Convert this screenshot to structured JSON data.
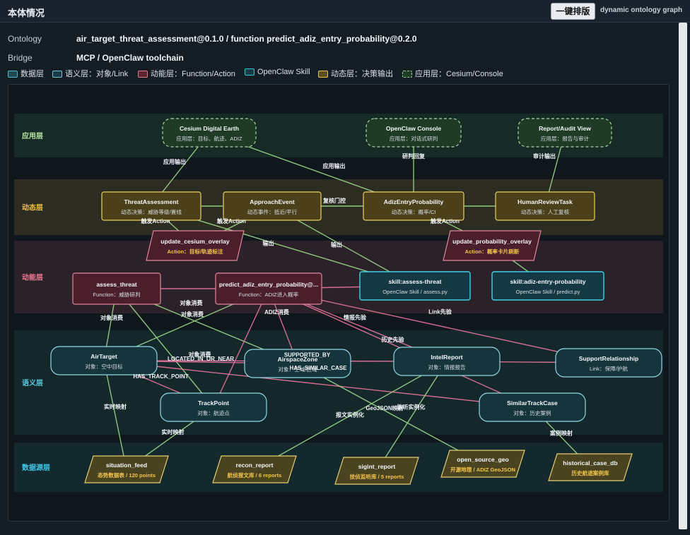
{
  "header": {
    "title": "本体情况",
    "layout_button": "一键排版",
    "subtitle": "dynamic ontology graph"
  },
  "info": {
    "ontology_label": "Ontology",
    "ontology_value": "air_target_threat_assessment@0.1.0 / function predict_adiz_entry_probability@0.2.0",
    "bridge_label": "Bridge",
    "bridge_value": "MCP / OpenClaw toolchain"
  },
  "legend": [
    {
      "label": "数据层",
      "color": "#1e4b52",
      "border": "#4fb7c6"
    },
    {
      "label": "语义层：对象/Link",
      "color": "#1c3b45",
      "border": "#6fc6d6"
    },
    {
      "label": "动能层：Function/Action",
      "color": "#5a2530",
      "border": "#e07890"
    },
    {
      "label": "OpenClaw Skill",
      "color": "#173c46",
      "border": "#36c3d8"
    },
    {
      "label": "动态层：决策输出",
      "color": "#5b4d1c",
      "border": "#e6c454"
    },
    {
      "label": "应用层：Cesium/Console",
      "color": "#1f3b25",
      "border": "#8fd18f"
    }
  ],
  "colors": {
    "app": {
      "band": "#162a26",
      "label": "#b8e6a0",
      "fill": "#1f3a25",
      "stroke": "#a5d8a0"
    },
    "dyn": {
      "band": "#2d2c22",
      "label": "#f0c040",
      "fill": "#4b4019",
      "stroke": "#ead060"
    },
    "func": {
      "band": "#2b2229",
      "label": "#f07890",
      "fill": "#4a1f2b",
      "stroke": "#e0869a"
    },
    "skill": {
      "fill": "#143942",
      "stroke": "#3ed2e8"
    },
    "sem": {
      "band": "#14282c",
      "label": "#58c8dc",
      "fill": "#15343c",
      "stroke": "#8fd8e4"
    },
    "data": {
      "band": "#14292e",
      "label": "#40c8e8",
      "fill": "#4a4320",
      "stroke": "#e8d070"
    },
    "edge_green": "#9bd68a",
    "edge_pink": "#e8749a"
  },
  "bands": [
    {
      "id": "app",
      "label": "应用层"
    },
    {
      "id": "dyn",
      "label": "动态层"
    },
    {
      "id": "func",
      "label": "动能层"
    },
    {
      "id": "sem",
      "label": "语义层"
    },
    {
      "id": "data",
      "label": "数据源层"
    }
  ],
  "nodes": [
    {
      "id": "cesium",
      "layer": "app",
      "title": "Cesium Digital Earth",
      "sub": "应用层：目标、航迹、ADIZ"
    },
    {
      "id": "console",
      "layer": "app",
      "title": "OpenClaw Console",
      "sub": "应用层：对话式研判"
    },
    {
      "id": "report",
      "layer": "app",
      "title": "Report/Audit View",
      "sub": "应用层：报告与审计"
    },
    {
      "id": "threat",
      "layer": "dyn",
      "title": "ThreatAssessment",
      "sub": "动态决策：威胁等级/置线"
    },
    {
      "id": "approach",
      "layer": "dyn",
      "title": "ApproachEvent",
      "sub": "动态事件：抵近/平行"
    },
    {
      "id": "adizprob",
      "layer": "dyn",
      "title": "AdizEntryProbability",
      "sub": "动态决策：概率/CI"
    },
    {
      "id": "humanreview",
      "layer": "dyn",
      "title": "HumanReviewTask",
      "sub": "动态决策：人工复核"
    },
    {
      "id": "updcesium",
      "layer": "action",
      "title": "update_cesium_overlay",
      "sub": "Action：目标/轨迹标注"
    },
    {
      "id": "updprob",
      "layer": "action",
      "title": "update_probability_overlay",
      "sub": "Action：概率卡片刷新"
    },
    {
      "id": "assess",
      "layer": "func",
      "title": "assess_threat",
      "sub": "Function：威胁研判"
    },
    {
      "id": "predict",
      "layer": "func",
      "title": "predict_adiz_entry_probability@...",
      "sub": "Function：ADIZ进入概率"
    },
    {
      "id": "skassess",
      "layer": "skill",
      "title": "skill:assess-threat",
      "sub": "OpenClaw Skill / assess.py"
    },
    {
      "id": "skadiz",
      "layer": "skill",
      "title": "skill:adiz-entry-probability",
      "sub": "OpenClaw Skill / predict.py"
    },
    {
      "id": "airtarget",
      "layer": "sem",
      "title": "AirTarget",
      "sub": "对象：空中目标"
    },
    {
      "id": "airspace",
      "layer": "sem",
      "title": "AirspaceZone",
      "sub": "对象：空域/区域"
    },
    {
      "id": "intel",
      "layer": "sem",
      "title": "IntelReport",
      "sub": "对象：情报报告"
    },
    {
      "id": "support",
      "layer": "sem",
      "title": "SupportRelationship",
      "sub": "Link：保障/护航"
    },
    {
      "id": "trackpoint",
      "layer": "sem",
      "title": "TrackPoint",
      "sub": "对象：航迹点"
    },
    {
      "id": "similar",
      "layer": "sem",
      "title": "SimilarTrackCase",
      "sub": "对象：历史案例"
    },
    {
      "id": "situation",
      "layer": "data",
      "title": "situation_feed",
      "sub": "态势数据表 / 120 points"
    },
    {
      "id": "recon",
      "layer": "data",
      "title": "recon_report",
      "sub": "航侦报文库 / 6 reports"
    },
    {
      "id": "sigint",
      "layer": "data",
      "title": "sigint_report",
      "sub": "技侦监听库 / 5 reports"
    },
    {
      "id": "osgeo",
      "layer": "data",
      "title": "open_source_geo",
      "sub": "开源地理 / ADIZ GeoJSON"
    },
    {
      "id": "histcase",
      "layer": "data",
      "title": "historical_case_db",
      "sub": "历史航迹案例库"
    }
  ],
  "edges": [
    {
      "from": "cesium",
      "to": "threat",
      "color": "green",
      "label": "应用输出"
    },
    {
      "from": "cesium",
      "to": "adizprob",
      "color": "green",
      "label": "应用输出"
    },
    {
      "from": "console",
      "to": "adizprob",
      "color": "green",
      "label": "研判回复"
    },
    {
      "from": "report",
      "to": "humanreview",
      "color": "green",
      "label": "审计输出"
    },
    {
      "from": "threat",
      "to": "approach",
      "color": "green",
      "label": ""
    },
    {
      "from": "approach",
      "to": "adizprob",
      "color": "green",
      "label": "复核门控"
    },
    {
      "from": "adizprob",
      "to": "humanreview",
      "color": "green",
      "label": ""
    },
    {
      "from": "threat",
      "to": "updcesium",
      "color": "green",
      "label": "触发Action"
    },
    {
      "from": "approach",
      "to": "updcesium",
      "color": "green",
      "label": "触发Action"
    },
    {
      "from": "adizprob",
      "to": "updprob",
      "color": "green",
      "label": "触发Action"
    },
    {
      "from": "threat",
      "to": "skassess",
      "color": "green",
      "label": "输出"
    },
    {
      "from": "approach",
      "to": "skassess",
      "color": "green",
      "label": "输出"
    },
    {
      "from": "updprob",
      "to": "skadiz",
      "color": "green",
      "label": ""
    },
    {
      "from": "assess",
      "to": "predict",
      "color": "pink",
      "label": ""
    },
    {
      "from": "predict",
      "to": "skassess",
      "color": "pink",
      "label": ""
    },
    {
      "from": "assess",
      "to": "airtarget",
      "color": "green",
      "label": "对象消费"
    },
    {
      "from": "assess",
      "to": "trackpoint",
      "color": "green",
      "label": "对象消费"
    },
    {
      "from": "assess",
      "to": "airspace",
      "color": "green",
      "label": "对象消费"
    },
    {
      "from": "predict",
      "to": "airtarget",
      "color": "green",
      "label": "对象消费"
    },
    {
      "from": "predict",
      "to": "trackpoint",
      "color": "pink",
      "label": ""
    },
    {
      "from": "predict",
      "to": "airspace",
      "color": "pink",
      "label": "ADIZ消费"
    },
    {
      "from": "predict",
      "to": "intel",
      "color": "pink",
      "label": "情报先验"
    },
    {
      "from": "predict",
      "to": "similar",
      "color": "pink",
      "label": "历史先验"
    },
    {
      "from": "predict",
      "to": "support",
      "color": "pink",
      "label": "Link先验"
    },
    {
      "from": "airtarget",
      "to": "airspace",
      "color": "pink",
      "label": "LOCATED_IN_OR_NEAR"
    },
    {
      "from": "airtarget",
      "to": "intel",
      "color": "pink",
      "label": "SUPPORTED_BY"
    },
    {
      "from": "airtarget",
      "to": "trackpoint",
      "color": "pink",
      "label": "HAS_TRACK_POINT"
    },
    {
      "from": "airtarget",
      "to": "similar",
      "color": "pink",
      "label": "HAS_SIMILAR_CASE"
    },
    {
      "from": "intel",
      "to": "support",
      "color": "pink",
      "label": ""
    },
    {
      "from": "airtarget",
      "to": "situation",
      "color": "green",
      "label": "实时映射"
    },
    {
      "from": "trackpoint",
      "to": "situation",
      "color": "green",
      "label": "实时映射"
    },
    {
      "from": "intel",
      "to": "recon",
      "color": "green",
      "label": "报文实例化"
    },
    {
      "from": "intel",
      "to": "sigint",
      "color": "green",
      "label": "监听实例化"
    },
    {
      "from": "airspace",
      "to": "osgeo",
      "color": "green",
      "label": "GeoJSON映射"
    },
    {
      "from": "similar",
      "to": "histcase",
      "color": "green",
      "label": "案例映射"
    }
  ]
}
